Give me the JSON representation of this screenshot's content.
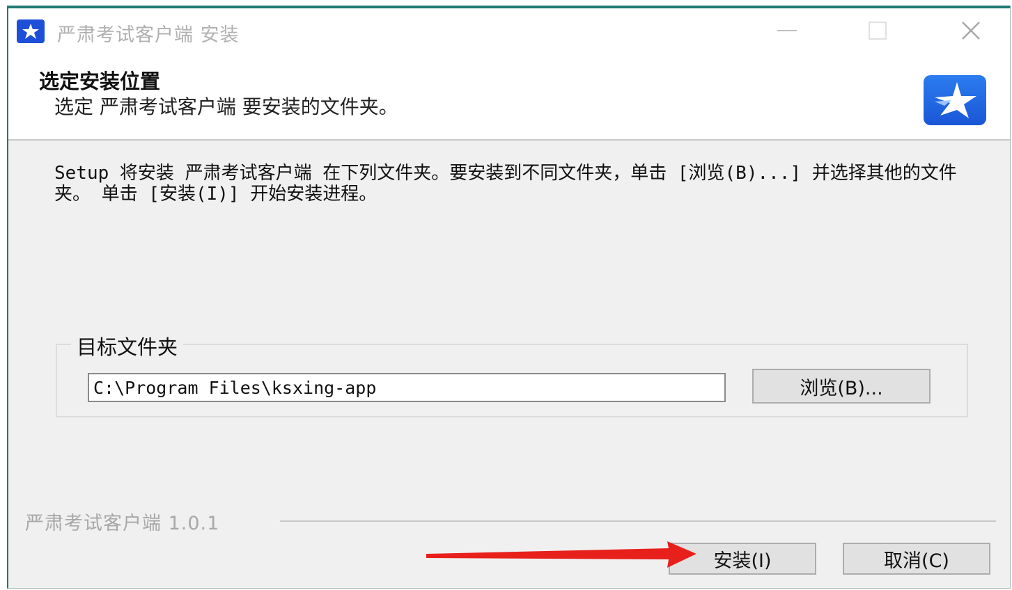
{
  "window": {
    "title": "严肃考试客户端 安装"
  },
  "header": {
    "title": "选定安装位置",
    "subtitle": "选定 严肃考试客户端 要安装的文件夹。"
  },
  "body": {
    "description": "Setup 将安装 严肃考试客户端 在下列文件夹。要安装到不同文件夹，单击 [浏览(B)...] 并选择其他的文件夹。 单击 [安装(I)] 开始安装进程。",
    "destination_group_label": "目标文件夹",
    "destination_path": "C:\\Program Files\\ksxing-app",
    "browse_label": "浏览(B)..."
  },
  "footer": {
    "brand_version": "严肃考试客户端 1.0.1",
    "install_label": "安装(I)",
    "cancel_label": "取消(C)"
  },
  "annotation": {
    "arrow_color": "#e8201c"
  },
  "icons": [
    "star-app-icon",
    "minimize-icon",
    "maximize-icon",
    "close-icon",
    "header-logo-icon"
  ]
}
